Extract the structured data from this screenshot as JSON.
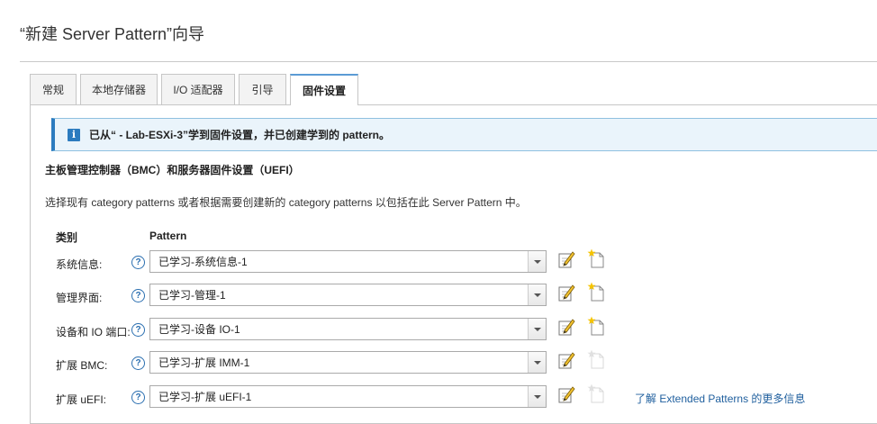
{
  "wizard": {
    "title": "“新建 Server Pattern”向导"
  },
  "tabs": [
    {
      "label": "常规",
      "active": false
    },
    {
      "label": "本地存储器",
      "active": false
    },
    {
      "label": "I/O 适配器",
      "active": false
    },
    {
      "label": "引导",
      "active": false
    },
    {
      "label": "固件设置",
      "active": true
    }
  ],
  "info": {
    "message": "已从“ - Lab-ESXi-3”学到固件设置，并已创建学到的 pattern。"
  },
  "section": {
    "title": "主板管理控制器（BMC）和服务器固件设置（UEFI）",
    "description": "选择现有 category patterns 或者根据需要创建新的 category patterns 以包括在此 Server Pattern 中。"
  },
  "columns": {
    "category": "类别",
    "pattern": "Pattern"
  },
  "rows": [
    {
      "label": "系统信息:",
      "value": "已学习-系统信息-1",
      "new_enabled": true
    },
    {
      "label": "管理界面:",
      "value": "已学习-管理-1",
      "new_enabled": true
    },
    {
      "label": "设备和 IO 端口:",
      "value": "已学习-设备 IO-1",
      "new_enabled": true
    },
    {
      "label": "扩展 BMC:",
      "value": "已学习-扩展 IMM-1",
      "new_enabled": false
    },
    {
      "label": "扩展 uEFI:",
      "value": "已学习-扩展 uEFI-1",
      "new_enabled": false
    }
  ],
  "help": {
    "glyph": "?"
  },
  "links": {
    "extended_patterns": "了解 Extended Patterns 的更多信息"
  },
  "icons": {
    "info": "info-icon",
    "help": "help-icon",
    "edit": "pencil-edit-icon",
    "new": "new-document-icon",
    "dropdown": "chevron-down-icon"
  },
  "colors": {
    "accent": "#2b7bbf",
    "info_background": "#eaf4fb",
    "link": "#1f5f9e",
    "new_star": "#f5c400"
  }
}
